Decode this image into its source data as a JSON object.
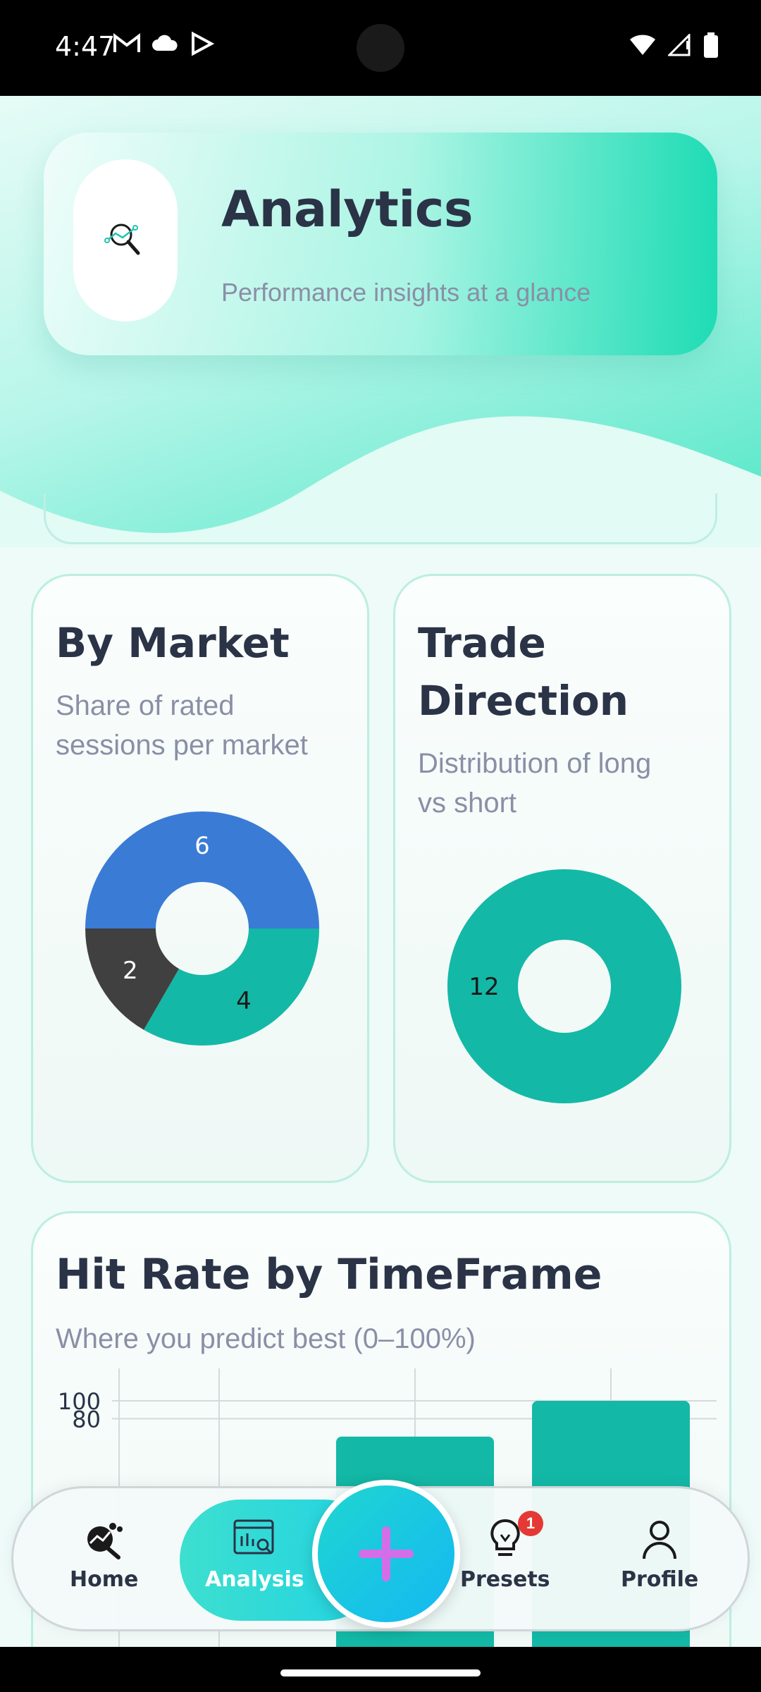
{
  "status_bar": {
    "time": "4:47"
  },
  "header": {
    "title": "Analytics",
    "subtitle": "Performance insights at a glance",
    "icon": "analytics-search-icon"
  },
  "market_card": {
    "title": "By Market",
    "subtitle_line1": "Share of rated",
    "subtitle_line2": "sessions per market"
  },
  "direction_card": {
    "title_line1": "Trade",
    "title_line2": "Direction",
    "subtitle_line1": "Distribution of long",
    "subtitle_line2": "vs short"
  },
  "hit_card": {
    "title": "Hit Rate by TimeFrame",
    "subtitle": "Where you predict best (0–100%)"
  },
  "chart_data": [
    {
      "type": "pie",
      "title": "By Market",
      "values": [
        6,
        4,
        2
      ],
      "colors": [
        "#3a7bd5",
        "#14b8a6",
        "#404040"
      ],
      "labels_shown": [
        "6",
        "4",
        "2"
      ]
    },
    {
      "type": "pie",
      "title": "Trade Direction",
      "values": [
        12
      ],
      "colors": [
        "#14b8a6"
      ],
      "labels_shown": [
        "12"
      ]
    },
    {
      "type": "bar",
      "title": "Hit Rate by TimeFrame",
      "ylim": [
        0,
        100
      ],
      "y_ticks_visible": [
        "100",
        "80"
      ],
      "values": [
        null,
        60,
        100
      ],
      "bar_color": "#14b8a6",
      "grid": true
    }
  ],
  "nav": {
    "home": "Home",
    "analysis": "Analysis",
    "presets": "Presets",
    "profile": "Profile",
    "presets_badge": "1",
    "accent": "#21d3e3"
  }
}
